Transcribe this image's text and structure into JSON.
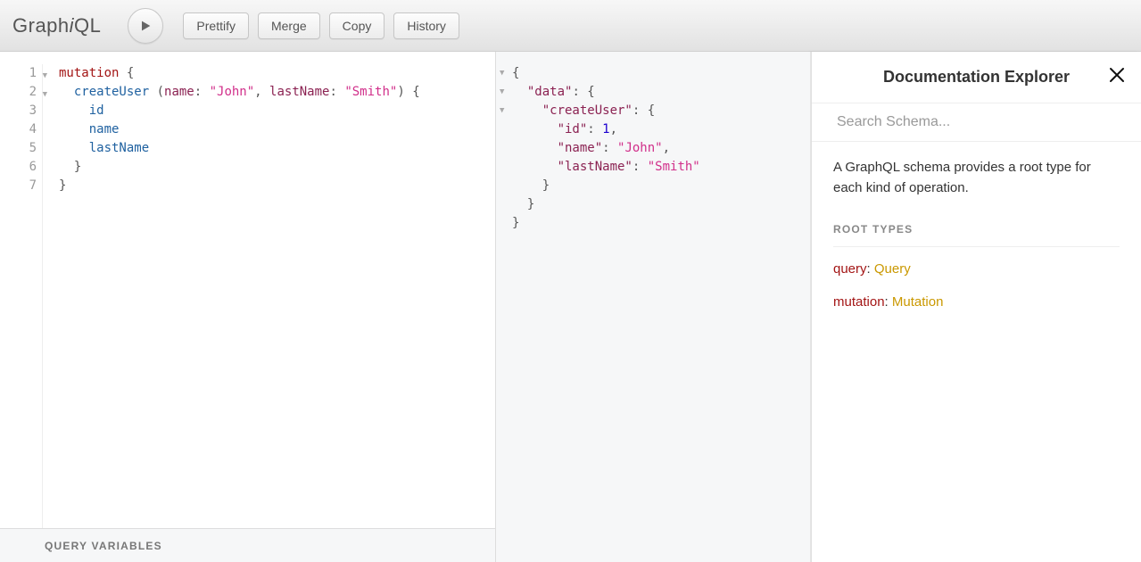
{
  "logo": {
    "prefix": "Graph",
    "italic": "i",
    "suffix": "QL"
  },
  "toolbar": {
    "prettify": "Prettify",
    "merge": "Merge",
    "copy": "Copy",
    "history": "History"
  },
  "editor": {
    "lines": [
      "1",
      "2",
      "3",
      "4",
      "5",
      "6",
      "7"
    ],
    "code": {
      "l1_kw": "mutation",
      "l1_brace": " {",
      "l2_indent": "  ",
      "l2_fn": "createUser",
      "l2_paren_open": " (",
      "l2_arg1": "name",
      "l2_colon1": ": ",
      "l2_str1": "\"John\"",
      "l2_comma": ", ",
      "l2_arg2": "lastName",
      "l2_colon2": ": ",
      "l2_str2": "\"Smith\"",
      "l2_paren_close": ") {",
      "l3_indent": "    ",
      "l3_field": "id",
      "l4_indent": "    ",
      "l4_field": "name",
      "l5_indent": "    ",
      "l5_field": "lastName",
      "l6": "  }",
      "l7": "}"
    },
    "query_variables_label": "QUERY VARIABLES"
  },
  "result": {
    "l1": "{",
    "l2_indent": "  ",
    "l2_key": "\"data\"",
    "l2_rest": ": {",
    "l3_indent": "    ",
    "l3_key": "\"createUser\"",
    "l3_rest": ": {",
    "l4_indent": "      ",
    "l4_key": "\"id\"",
    "l4_colon": ": ",
    "l4_val": "1",
    "l4_comma": ",",
    "l5_indent": "      ",
    "l5_key": "\"name\"",
    "l5_colon": ": ",
    "l5_val": "\"John\"",
    "l5_comma": ",",
    "l6_indent": "      ",
    "l6_key": "\"lastName\"",
    "l6_colon": ": ",
    "l6_val": "\"Smith\"",
    "l7": "    }",
    "l8": "  }",
    "l9": "}"
  },
  "docs": {
    "title": "Documentation Explorer",
    "search_placeholder": "Search Schema...",
    "description": "A GraphQL schema provides a root type for each kind of operation.",
    "section": "ROOT TYPES",
    "root1_key": "query",
    "root1_sep": ": ",
    "root1_type": "Query",
    "root2_key": "mutation",
    "root2_sep": ": ",
    "root2_type": "Mutation"
  }
}
